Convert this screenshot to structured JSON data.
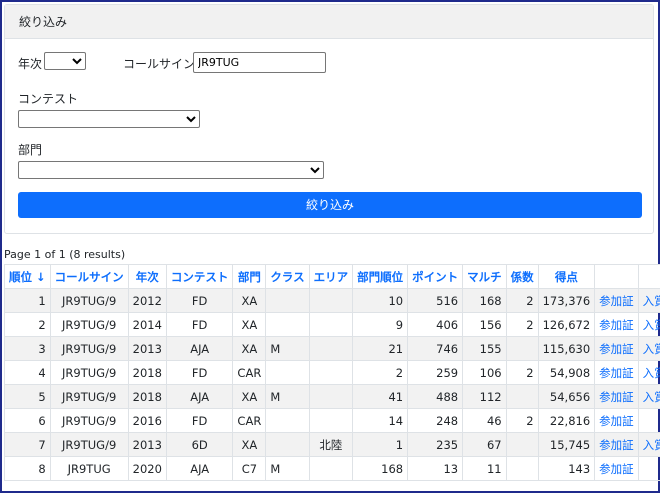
{
  "filter": {
    "title": "絞り込み",
    "year_label": "年次",
    "year_value": "",
    "callsign_label": "コールサイン",
    "callsign_value": "JR9TUG",
    "contest_label": "コンテスト",
    "contest_value": "",
    "category_label": "部門",
    "category_value": "",
    "submit_label": "絞り込み"
  },
  "results_summary": "Page 1 of 1 (8 results)",
  "table": {
    "headers": [
      "順位 ↓",
      "コールサイン",
      "年次",
      "コンテスト",
      "部門",
      "クラス",
      "エリア",
      "部門順位",
      "ポイント",
      "マルチ",
      "係数",
      "得点",
      "",
      ""
    ],
    "rows": [
      [
        "1",
        "JR9TUG/9",
        "2012",
        "FD",
        "XA",
        "",
        "",
        "10",
        "516",
        "168",
        "2",
        "173,376",
        "参加証",
        "入賞"
      ],
      [
        "2",
        "JR9TUG/9",
        "2014",
        "FD",
        "XA",
        "",
        "",
        "9",
        "406",
        "156",
        "2",
        "126,672",
        "参加証",
        "入賞"
      ],
      [
        "3",
        "JR9TUG/9",
        "2013",
        "AJA",
        "XA",
        "M",
        "",
        "21",
        "746",
        "155",
        "",
        "115,630",
        "参加証",
        "入賞"
      ],
      [
        "4",
        "JR9TUG/9",
        "2018",
        "FD",
        "CAR",
        "",
        "",
        "2",
        "259",
        "106",
        "2",
        "54,908",
        "参加証",
        "入賞"
      ],
      [
        "5",
        "JR9TUG/9",
        "2018",
        "AJA",
        "XA",
        "M",
        "",
        "41",
        "488",
        "112",
        "",
        "54,656",
        "参加証",
        "入賞"
      ],
      [
        "6",
        "JR9TUG/9",
        "2016",
        "FD",
        "CAR",
        "",
        "",
        "14",
        "248",
        "46",
        "2",
        "22,816",
        "参加証",
        ""
      ],
      [
        "7",
        "JR9TUG/9",
        "2013",
        "6D",
        "XA",
        "",
        "北陸",
        "1",
        "235",
        "67",
        "",
        "15,745",
        "参加証",
        "入賞"
      ],
      [
        "8",
        "JR9TUG",
        "2020",
        "AJA",
        "C7",
        "M",
        "",
        "168",
        "13",
        "11",
        "",
        "143",
        "参加証",
        ""
      ]
    ]
  }
}
